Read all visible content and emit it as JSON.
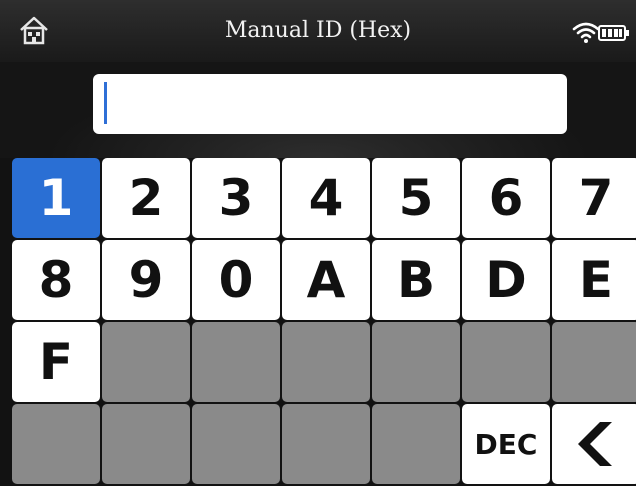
{
  "header": {
    "title": "Manual ID (Hex)",
    "icons": [
      "home-icon",
      "wifi-icon",
      "battery-icon"
    ]
  },
  "id_input": {
    "value": ""
  },
  "keypad": {
    "row1": [
      "1",
      "2",
      "3",
      "4",
      "5",
      "6",
      "7"
    ],
    "row2": [
      "8",
      "9",
      "0",
      "A",
      "B",
      "D",
      "E"
    ],
    "row3": [
      "F"
    ],
    "dec_label": "DEC",
    "selected_key": "1"
  },
  "colors": {
    "accent": "#2a6fd4",
    "key": "#ffffff",
    "blank_key": "#8a8a8a",
    "background": "#121212"
  }
}
